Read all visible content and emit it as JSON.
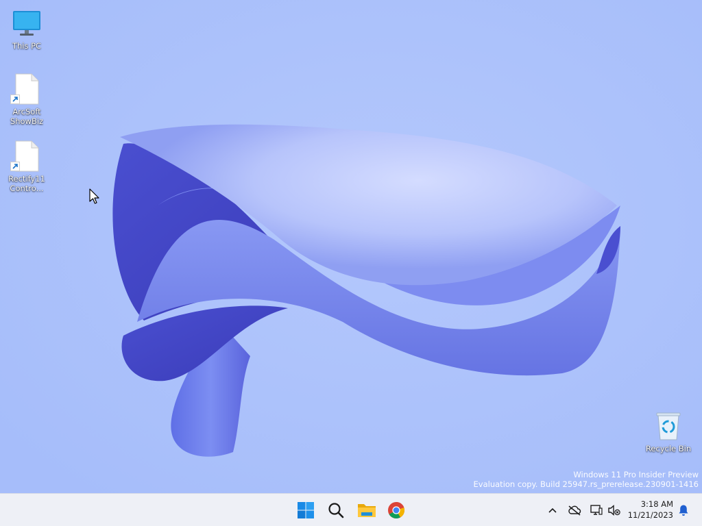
{
  "desktop": {
    "icons": [
      {
        "label": "This PC",
        "icon": "monitor-icon"
      },
      {
        "label": "ArcSoft\nShowBiz",
        "icon": "file-shortcut-icon"
      },
      {
        "label": "Rectify11\nContro...",
        "icon": "file-shortcut-icon"
      },
      {
        "label": "Recycle Bin",
        "icon": "recycle-bin-icon"
      }
    ]
  },
  "watermark": {
    "line1": "Windows 11 Pro Insider Preview",
    "line2": "Evaluation copy. Build 25947.rs_prerelease.230901-1416"
  },
  "taskbar": {
    "apps": [
      {
        "name": "Start",
        "icon": "windows-logo-icon"
      },
      {
        "name": "Search",
        "icon": "search-icon"
      },
      {
        "name": "File Explorer",
        "icon": "folder-icon"
      },
      {
        "name": "Google Chrome",
        "icon": "chrome-icon"
      }
    ],
    "tray": {
      "time": "3:18 AM",
      "date": "11/21/2023"
    }
  },
  "colors": {
    "wallpaper": "#a9c0fb",
    "accent": "#0067c0"
  }
}
